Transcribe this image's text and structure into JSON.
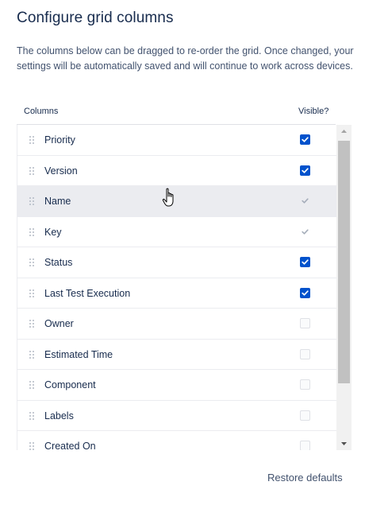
{
  "dialog": {
    "title": "Configure grid columns",
    "description": "The columns below can be dragged to re-order the grid. Once changed, your settings will be automatically saved and will continue to work across devices."
  },
  "table": {
    "columns_header": "Columns",
    "visible_header": "Visible?",
    "rows": [
      {
        "label": "Priority",
        "state": "checked"
      },
      {
        "label": "Version",
        "state": "checked"
      },
      {
        "label": "Name",
        "state": "disabled-checked"
      },
      {
        "label": "Key",
        "state": "disabled-checked"
      },
      {
        "label": "Status",
        "state": "checked"
      },
      {
        "label": "Last Test Execution",
        "state": "checked"
      },
      {
        "label": "Owner",
        "state": "unchecked"
      },
      {
        "label": "Estimated Time",
        "state": "unchecked"
      },
      {
        "label": "Component",
        "state": "unchecked"
      },
      {
        "label": "Labels",
        "state": "unchecked"
      },
      {
        "label": "Created On",
        "state": "unchecked"
      }
    ]
  },
  "footer": {
    "restore_label": "Restore defaults"
  },
  "colors": {
    "accent": "#0052cc",
    "text": "#172b4d",
    "subtle_text": "#42526e",
    "row_hover": "#ebecf0"
  }
}
